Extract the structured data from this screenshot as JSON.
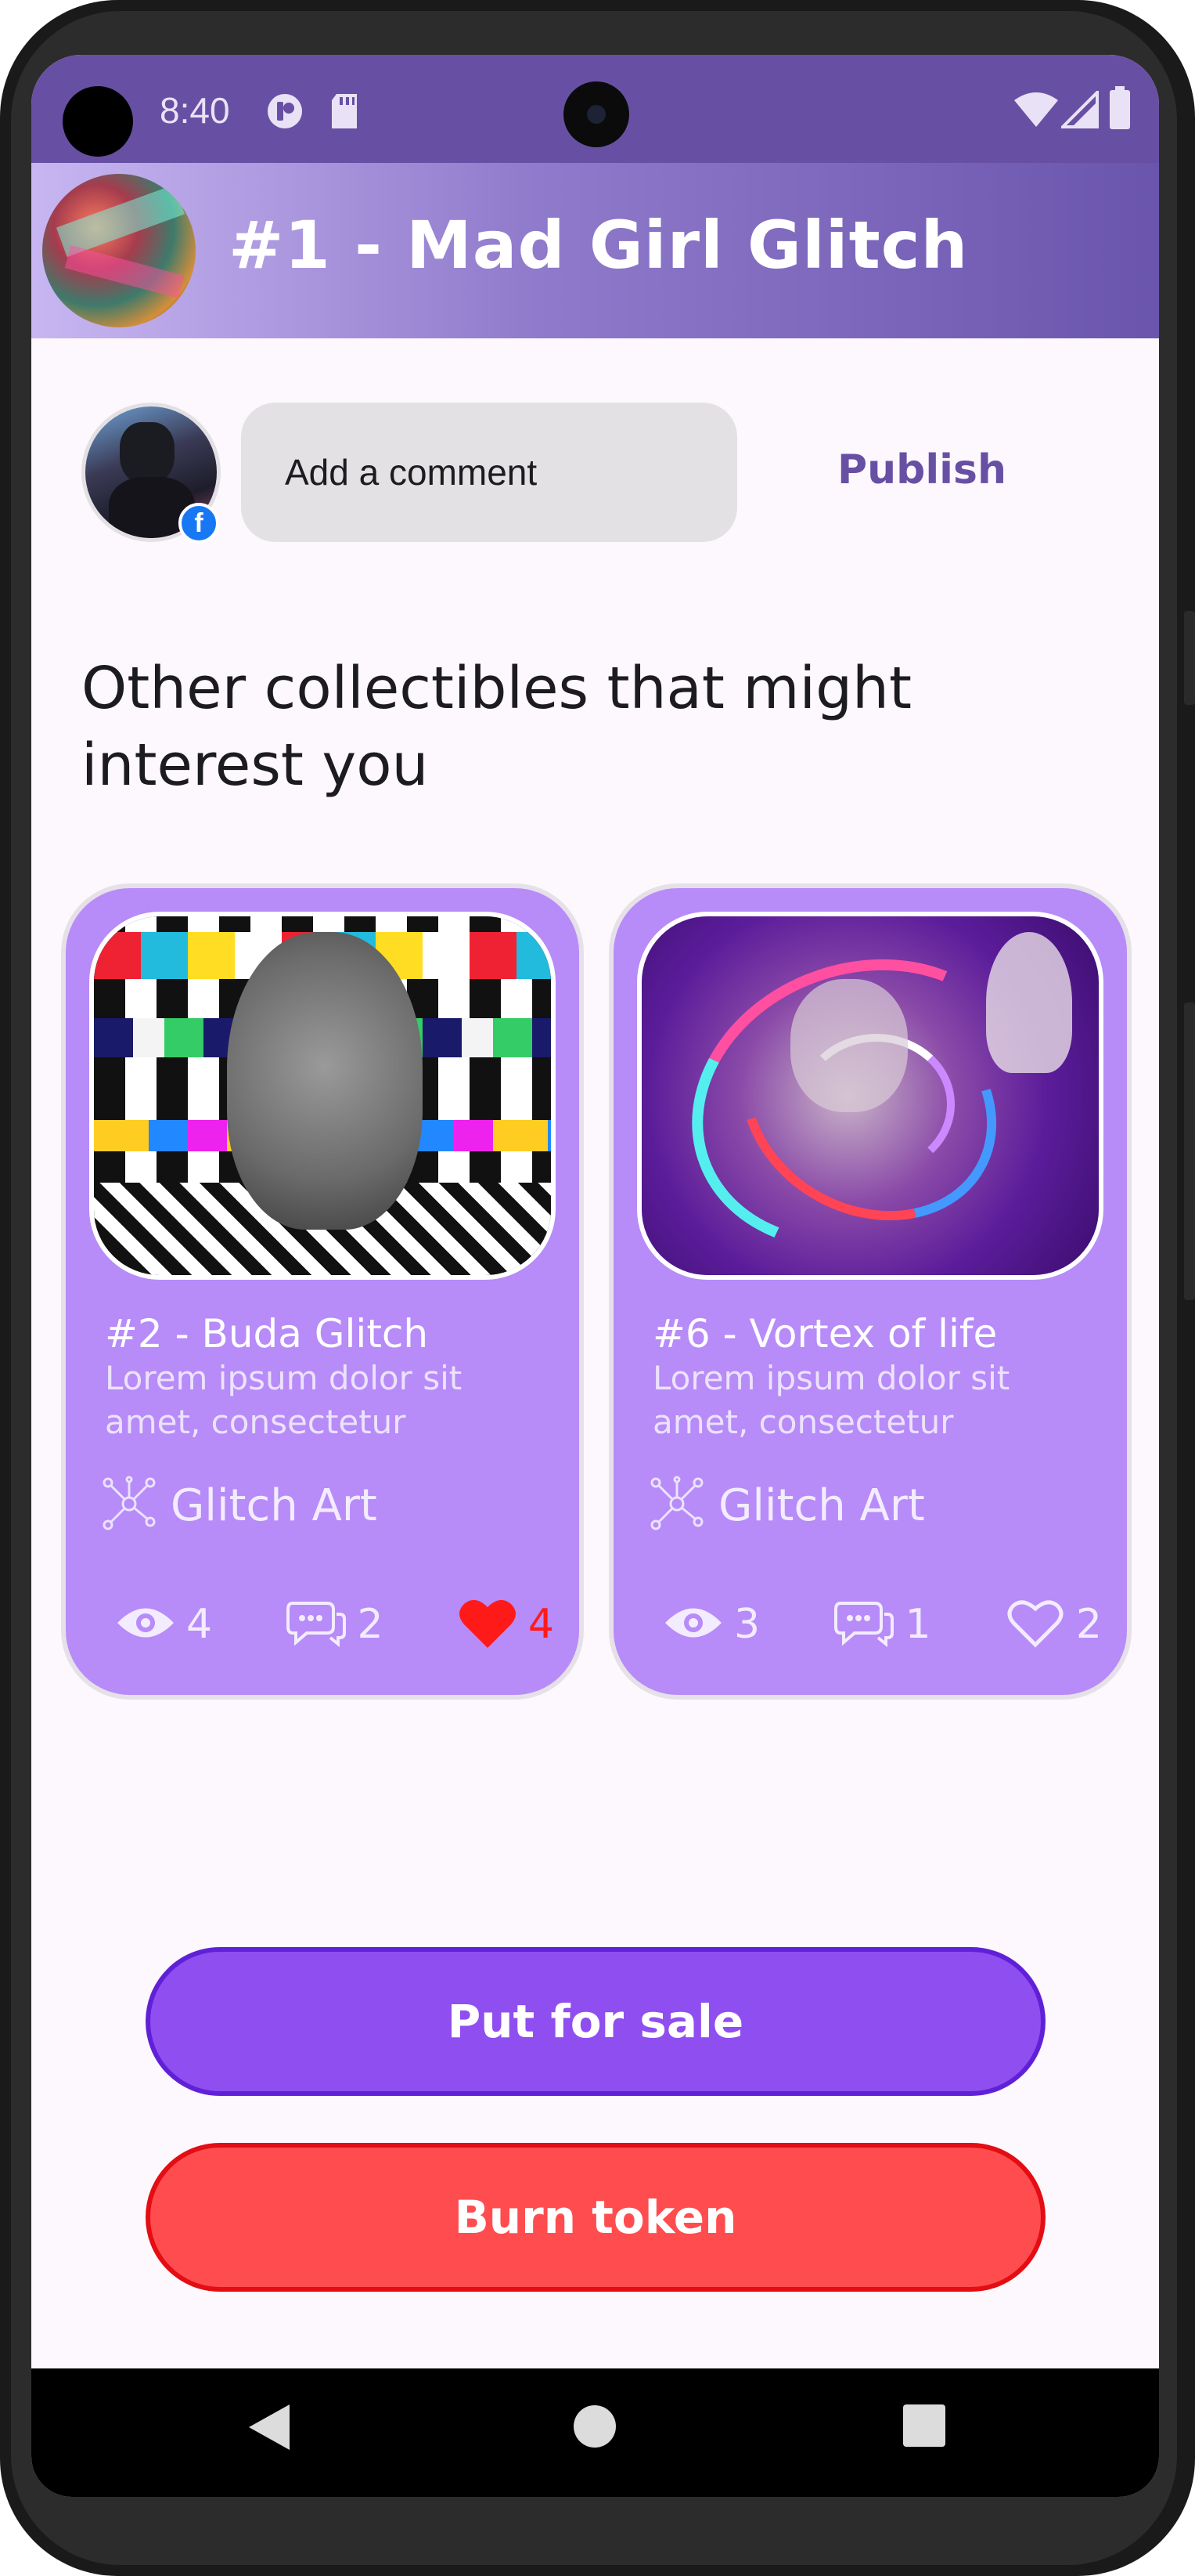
{
  "status_bar": {
    "time": "8:40",
    "icons": [
      "media-icon",
      "sd-card-icon",
      "wifi-icon",
      "signal-icon",
      "battery-icon"
    ]
  },
  "app_bar": {
    "title": "#1 - Mad Girl Glitch"
  },
  "comment": {
    "placeholder": "Add a comment",
    "badge": "f",
    "publish_label": "Publish"
  },
  "section": {
    "heading": "Other collectibles that might interest you"
  },
  "cards": [
    {
      "title": "#2 - Buda Glitch",
      "description": "Lorem ipsum dolor sit amet, consectetur",
      "category": "Glitch Art",
      "views": "4",
      "comments": "2",
      "likes": "4",
      "liked": true
    },
    {
      "title": "#6 - Vortex of life",
      "description": "Lorem ipsum dolor sit amet, consectetur",
      "category": "Glitch Art",
      "views": "3",
      "comments": "1",
      "likes": "2",
      "liked": false
    }
  ],
  "actions": {
    "sale_label": "Put for sale",
    "burn_label": "Burn token"
  },
  "colors": {
    "primary": "#6750a4",
    "card": "#b78bf8",
    "sale": "#8f4ef0",
    "burn": "#ff4d4f",
    "like": "#ff1a1a"
  }
}
